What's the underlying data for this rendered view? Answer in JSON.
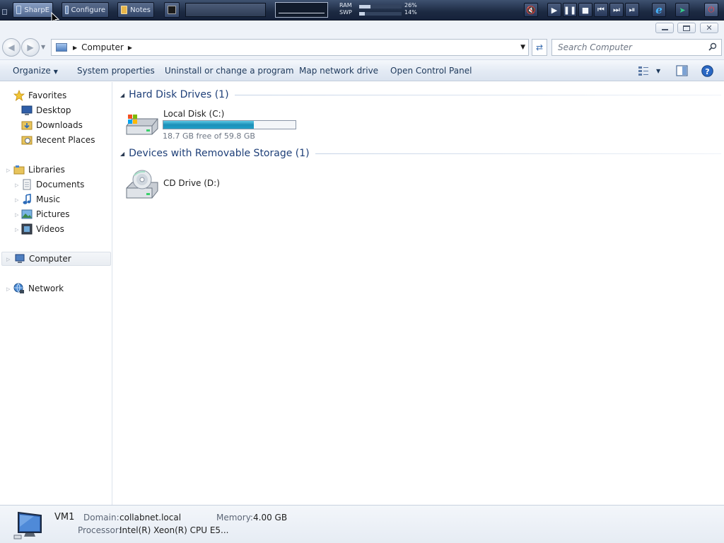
{
  "taskbar": {
    "buttons": [
      {
        "label": "SharpE"
      },
      {
        "label": "Configure"
      },
      {
        "label": "Notes"
      }
    ],
    "meters": [
      {
        "label": "RAM",
        "value": "26%",
        "fraction": 0.26
      },
      {
        "label": "SWP",
        "value": "14%",
        "fraction": 0.14
      }
    ]
  },
  "address_bar": {
    "breadcrumb": [
      "Computer"
    ]
  },
  "search": {
    "placeholder": "Search Computer"
  },
  "command_bar": {
    "organize": "Organize",
    "system_properties": "System properties",
    "uninstall": "Uninstall or change a program",
    "map_drive": "Map network drive",
    "control_panel": "Open Control Panel"
  },
  "nav_pane": {
    "favorites": {
      "label": "Favorites",
      "items": [
        "Desktop",
        "Downloads",
        "Recent Places"
      ]
    },
    "libraries": {
      "label": "Libraries",
      "items": [
        "Documents",
        "Music",
        "Pictures",
        "Videos"
      ]
    },
    "computer": "Computer",
    "network": "Network"
  },
  "content": {
    "groups": [
      {
        "title": "Hard Disk Drives (1)",
        "drives": [
          {
            "name": "Local Disk (C:)",
            "free_text": "18.7 GB free of 59.8 GB",
            "used_fraction": 0.687
          }
        ]
      },
      {
        "title": "Devices with Removable Storage (1)",
        "drives": [
          {
            "name": "CD Drive (D:)"
          }
        ]
      }
    ]
  },
  "details": {
    "name": "VM1",
    "domain_label": "Domain:",
    "domain": "collabnet.local",
    "memory_label": "Memory:",
    "memory": "4.00 GB",
    "processor_label": "Processor:",
    "processor": "Intel(R) Xeon(R) CPU E5..."
  },
  "colors": {
    "group_title": "#1e3f78",
    "command_text": "#1e395b",
    "drive_bar": "#1c8fb8"
  }
}
